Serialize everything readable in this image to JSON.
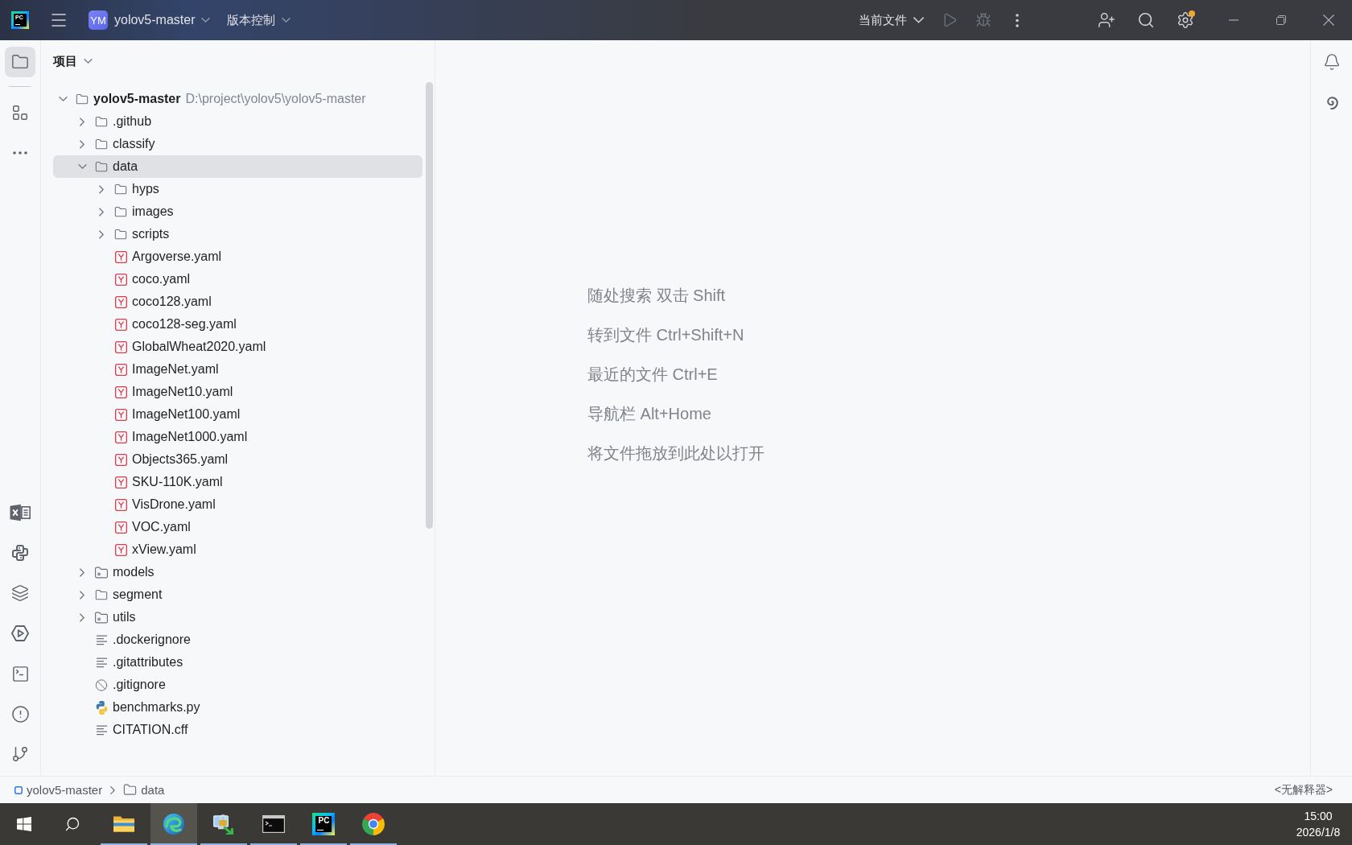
{
  "title_bar": {
    "logo_text": "PC",
    "project_badge": "YM",
    "project_name": "yolov5-master",
    "vcs_menu": "版本控制",
    "run_config": "当前文件",
    "run": {
      "disabled": true
    },
    "debug": {
      "disabled": true
    },
    "settings_badge": true
  },
  "left_toolbar": {
    "top": [
      {
        "kind": "project",
        "selected": true
      },
      {
        "kind": "structure",
        "selected": false
      },
      {
        "kind": "more",
        "selected": false
      }
    ],
    "bottom": [
      {
        "kind": "spreadsheet",
        "selected": false
      },
      {
        "kind": "python",
        "selected": false
      },
      {
        "kind": "layers",
        "selected": false
      },
      {
        "kind": "services",
        "selected": false
      },
      {
        "kind": "terminal",
        "selected": false
      },
      {
        "kind": "problems",
        "selected": false
      },
      {
        "kind": "git",
        "selected": false
      }
    ]
  },
  "project_panel": {
    "title": "项目",
    "tree": [
      {
        "kind": "folder",
        "label": "yolov5-master",
        "path": "D:\\project\\yolov5\\yolov5-master",
        "expanded": true,
        "selected": false,
        "children": [
          {
            "kind": "folder",
            "label": ".github",
            "expanded": false,
            "selected": false
          },
          {
            "kind": "folder",
            "label": "classify",
            "expanded": false,
            "selected": false
          },
          {
            "kind": "folder",
            "label": "data",
            "expanded": true,
            "selected": true,
            "children": [
              {
                "kind": "folder",
                "label": "hyps",
                "expanded": false,
                "selected": false
              },
              {
                "kind": "folder",
                "label": "images",
                "expanded": false,
                "selected": false
              },
              {
                "kind": "folder",
                "label": "scripts",
                "expanded": false,
                "selected": false
              },
              {
                "kind": "yaml",
                "label": "Argoverse.yaml",
                "selected": false
              },
              {
                "kind": "yaml",
                "label": "coco.yaml",
                "selected": false
              },
              {
                "kind": "yaml",
                "label": "coco128.yaml",
                "selected": false
              },
              {
                "kind": "yaml",
                "label": "coco128-seg.yaml",
                "selected": false
              },
              {
                "kind": "yaml",
                "label": "GlobalWheat2020.yaml",
                "selected": false
              },
              {
                "kind": "yaml",
                "label": "ImageNet.yaml",
                "selected": false
              },
              {
                "kind": "yaml",
                "label": "ImageNet10.yaml",
                "selected": false
              },
              {
                "kind": "yaml",
                "label": "ImageNet100.yaml",
                "selected": false
              },
              {
                "kind": "yaml",
                "label": "ImageNet1000.yaml",
                "selected": false
              },
              {
                "kind": "yaml",
                "label": "Objects365.yaml",
                "selected": false
              },
              {
                "kind": "yaml",
                "label": "SKU-110K.yaml",
                "selected": false
              },
              {
                "kind": "yaml",
                "label": "VisDrone.yaml",
                "selected": false
              },
              {
                "kind": "yaml",
                "label": "VOC.yaml",
                "selected": false
              },
              {
                "kind": "yaml",
                "label": "xView.yaml",
                "selected": false
              }
            ]
          },
          {
            "kind": "package",
            "label": "models",
            "expanded": false,
            "selected": false
          },
          {
            "kind": "folder",
            "label": "segment",
            "expanded": false,
            "selected": false
          },
          {
            "kind": "package",
            "label": "utils",
            "expanded": false,
            "selected": false
          },
          {
            "kind": "text",
            "label": ".dockerignore",
            "selected": false
          },
          {
            "kind": "text",
            "label": ".gitattributes",
            "selected": false
          },
          {
            "kind": "ignore",
            "label": ".gitignore",
            "selected": false
          },
          {
            "kind": "python",
            "label": "benchmarks.py",
            "selected": false
          },
          {
            "kind": "text",
            "label": "CITATION.cff",
            "selected": false
          }
        ]
      }
    ]
  },
  "editor": {
    "hints": [
      "随处搜索 双击 Shift",
      "转到文件 Ctrl+Shift+N",
      "最近的文件 Ctrl+E",
      "导航栏 Alt+Home",
      "将文件拖放到此处以打开"
    ]
  },
  "status_bar": {
    "breadcrumbs": [
      {
        "kind": "module",
        "label": "yolov5-master"
      },
      {
        "kind": "folder",
        "label": "data"
      }
    ],
    "interpreter": "<无解释器>"
  },
  "taskbar": {
    "apps": [
      {
        "kind": "file_manager",
        "selected": false,
        "running": true
      },
      {
        "kind": "swirl_browser",
        "selected": true,
        "running": true
      },
      {
        "kind": "remote_access",
        "selected": false,
        "running": true
      },
      {
        "kind": "console",
        "selected": false,
        "running": true
      },
      {
        "kind": "ide",
        "label": "PC",
        "selected": false,
        "running": true
      },
      {
        "kind": "ring_browser",
        "selected": false,
        "running": true
      }
    ],
    "time": "15:00",
    "date": "2026/1/8"
  }
}
